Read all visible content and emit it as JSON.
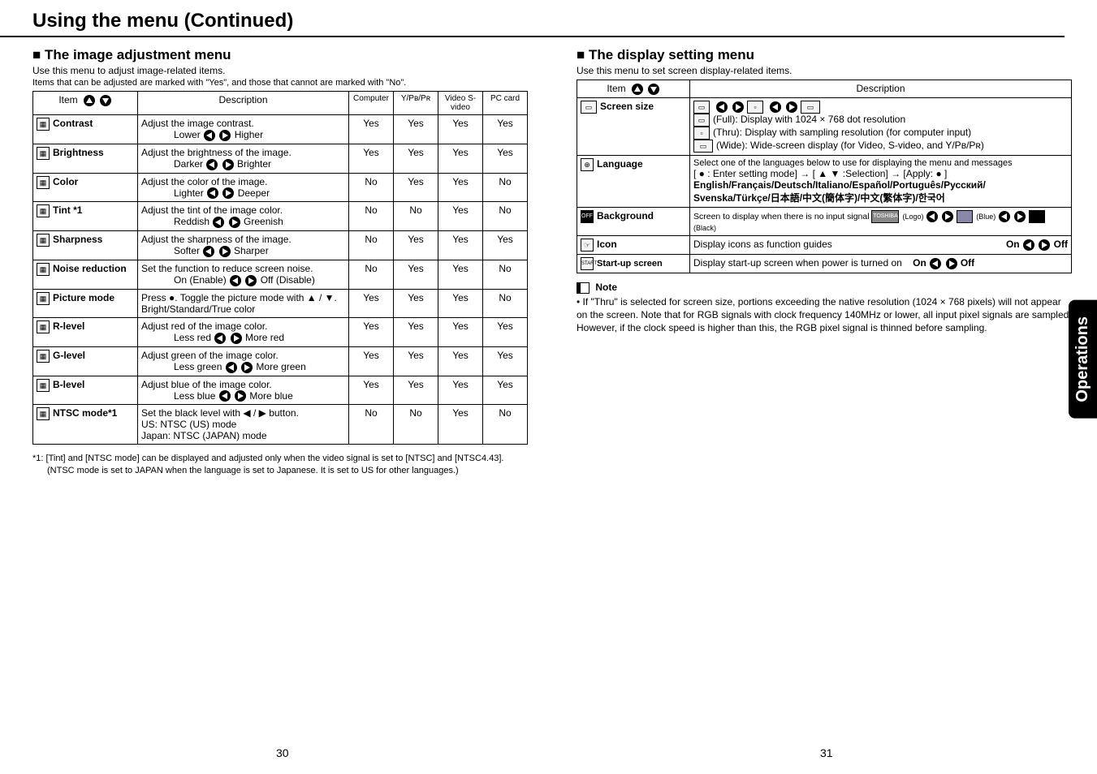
{
  "page_title": "Using the menu (Continued)",
  "left": {
    "heading": "The image adjustment menu",
    "sub1": "Use this menu to adjust image-related items.",
    "sub2": "Items that can be adjusted are marked with \"Yes\", and those that cannot are marked with \"No\".",
    "headers": {
      "item": "Item",
      "desc": "Description",
      "c1": "Computer",
      "c2": "Y/Pʙ/Pʀ",
      "c3": "Video S-video",
      "c4": "PC card"
    },
    "rows": [
      {
        "name": "Contrast",
        "desc": "Adjust the image contrast.",
        "line2a": "Lower",
        "line2b": "Higher",
        "v": [
          "Yes",
          "Yes",
          "Yes",
          "Yes"
        ]
      },
      {
        "name": "Brightness",
        "desc": "Adjust the brightness of the image.",
        "line2a": "Darker",
        "line2b": "Brighter",
        "v": [
          "Yes",
          "Yes",
          "Yes",
          "Yes"
        ]
      },
      {
        "name": "Color",
        "desc": "Adjust the color of the image.",
        "line2a": "Lighter",
        "line2b": "Deeper",
        "v": [
          "No",
          "Yes",
          "Yes",
          "No"
        ]
      },
      {
        "name": "Tint *1",
        "desc": "Adjust the tint of the image color.",
        "line2a": "Reddish",
        "line2b": "Greenish",
        "v": [
          "No",
          "No",
          "Yes",
          "No"
        ]
      },
      {
        "name": "Sharpness",
        "desc": "Adjust the sharpness of the image.",
        "line2a": "Softer",
        "line2b": "Sharper",
        "v": [
          "No",
          "Yes",
          "Yes",
          "Yes"
        ]
      },
      {
        "name": "Noise reduction",
        "desc": "Set the function to reduce screen noise.",
        "line2a": "On (Enable)",
        "line2b": "Off (Disable)",
        "v": [
          "No",
          "Yes",
          "Yes",
          "No"
        ]
      },
      {
        "name": "Picture mode",
        "desc": "Press ●. Toggle the picture mode with ▲ / ▼.\nBright/Standard/True color",
        "v": [
          "Yes",
          "Yes",
          "Yes",
          "No"
        ]
      },
      {
        "name": "R-level",
        "desc": "Adjust red of the image color.",
        "line2a": "Less red",
        "line2b": "More red",
        "v": [
          "Yes",
          "Yes",
          "Yes",
          "Yes"
        ]
      },
      {
        "name": "G-level",
        "desc": "Adjust green of the image color.",
        "line2a": "Less green",
        "line2b": "More green",
        "v": [
          "Yes",
          "Yes",
          "Yes",
          "Yes"
        ]
      },
      {
        "name": "B-level",
        "desc": "Adjust blue of the image color.",
        "line2a": "Less blue",
        "line2b": "More blue",
        "v": [
          "Yes",
          "Yes",
          "Yes",
          "Yes"
        ]
      },
      {
        "name": "NTSC mode*1",
        "desc": "Set the black level with ◀ / ▶ button.\nUS:      NTSC (US) mode\nJapan:  NTSC (JAPAN) mode",
        "v": [
          "No",
          "No",
          "Yes",
          "No"
        ]
      }
    ],
    "footnote": "*1: [Tint] and [NTSC mode] can be displayed and adjusted only when the video signal is set to [NTSC] and [NTSC4.43]. (NTSC mode is set to JAPAN when the language is set to Japanese. It is set to US for other languages.)"
  },
  "right": {
    "heading": "The display setting menu",
    "sub1": "Use this menu to set screen display-related items.",
    "headers": {
      "item": "Item",
      "desc": "Description"
    },
    "rows": {
      "r1": {
        "name": "Screen size",
        "line1": "(Full):  Display with 1024 × 768 dot resolution",
        "line2": "(Thru): Display with sampling resolution (for computer input)",
        "line3": "(Wide): Wide-screen display (for Video, S-video, and Y/Pʙ/Pʀ)"
      },
      "r2": {
        "name": "Language",
        "line1": "Select one of the languages below to use for displaying the menu and messages",
        "line2": "[ ● : Enter setting mode] → [ ▲ ▼ :Selection] → [Apply: ● ]",
        "line3": "English/Français/Deutsch/Italiano/Español/Português/Русский/",
        "line4": "Svenska/Türkçe/日本語/中文(簡体字)/中文(繁体字)/한국어"
      },
      "r3": {
        "name": "Background",
        "desc": "Screen to display when there is no input signal",
        "opt1": "(Logo)",
        "opt2": "(Blue)",
        "opt3": "(Black)"
      },
      "r4": {
        "name": "Icon",
        "desc": "Display icons as function guides",
        "on": "On",
        "off": "Off"
      },
      "r5": {
        "name": "Start-up screen",
        "desc": "Display start-up screen when power is turned on",
        "on": "On",
        "off": "Off"
      }
    },
    "note_head": "Note",
    "note_text": "• If \"Thru\" is selected for screen size, portions exceeding the native resolution (1024 × 768 pixels) will not appear on the screen. Note that for RGB signals with clock frequency 140MHz or lower, all input pixel signals are sampled. However, if the clock speed is higher than this, the RGB pixel signal is thinned before sampling."
  },
  "side_tab": "Operations",
  "page_left": "30",
  "page_right": "31"
}
